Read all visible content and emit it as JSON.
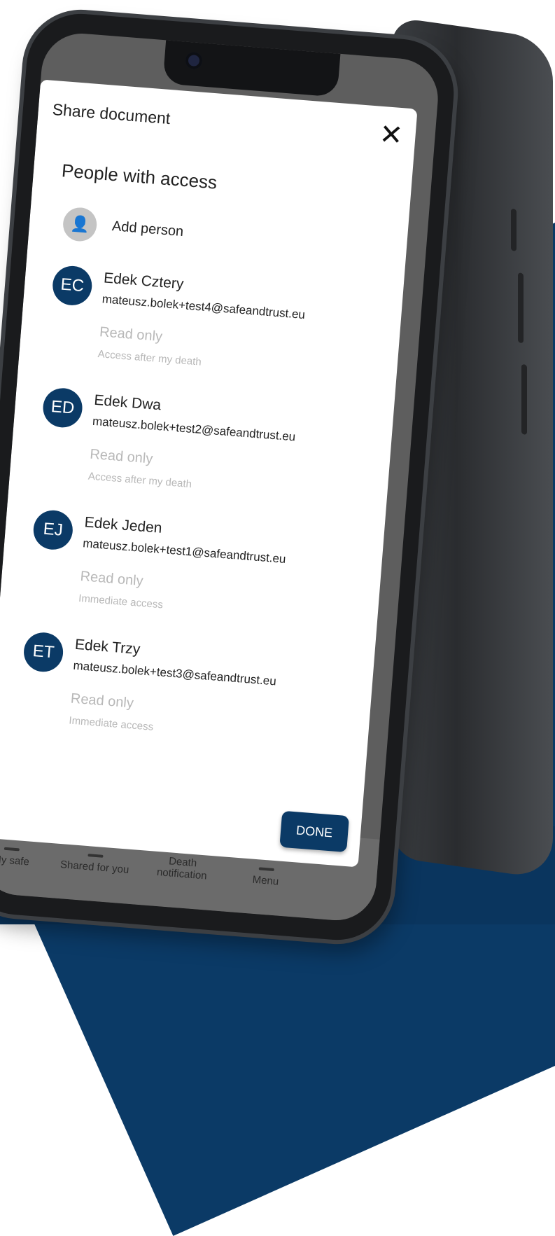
{
  "dialog": {
    "title": "Share document",
    "close_icon": "close-icon",
    "section_title": "People with access",
    "add_person_label": "Add person",
    "add_person_icon": "add-person-icon",
    "done_label": "DONE"
  },
  "people": [
    {
      "initials": "EC",
      "name": "Edek Cztery",
      "email": "mateusz.bolek+test4@safeandtrust.eu",
      "role": "Read only",
      "access": "Access after my death"
    },
    {
      "initials": "ED",
      "name": "Edek Dwa",
      "email": "mateusz.bolek+test2@safeandtrust.eu",
      "role": "Read only",
      "access": "Access after my death"
    },
    {
      "initials": "EJ",
      "name": "Edek Jeden",
      "email": "mateusz.bolek+test1@safeandtrust.eu",
      "role": "Read only",
      "access": "Immediate access"
    },
    {
      "initials": "ET",
      "name": "Edek Trzy",
      "email": "mateusz.bolek+test3@safeandtrust.eu",
      "role": "Read only",
      "access": "Immediate access"
    }
  ],
  "bottom_nav": [
    {
      "label": "My safe"
    },
    {
      "label": "Shared for you"
    },
    {
      "label": "Death notification"
    },
    {
      "label": "Menu"
    }
  ],
  "colors": {
    "accent": "#0b3a66",
    "muted_text": "#b8b8b8",
    "avatar_placeholder": "#c4c4c4"
  }
}
